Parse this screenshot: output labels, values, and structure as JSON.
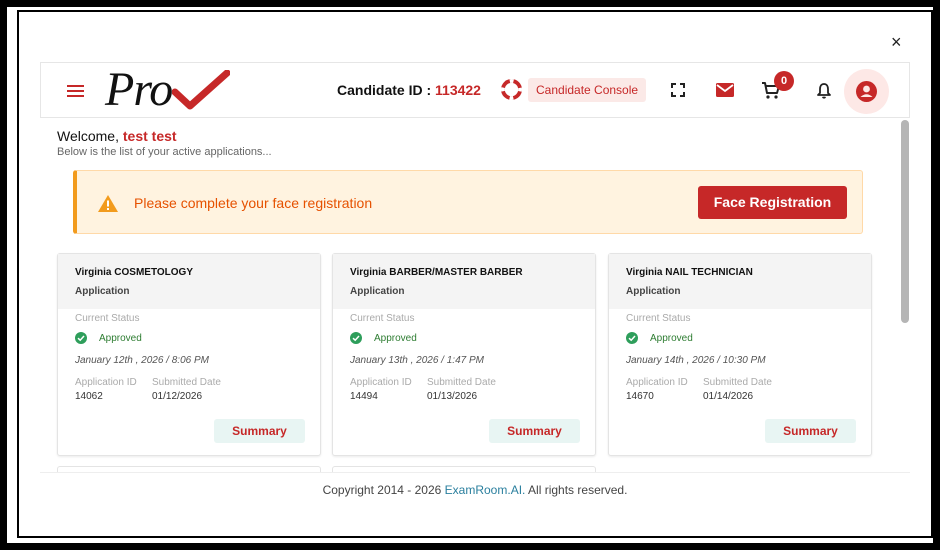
{
  "window": {
    "close_label": "×"
  },
  "header": {
    "logo_text": "Pro",
    "candidate_label": "Candidate ID : ",
    "candidate_id": "113422",
    "console_label": "Candidate Console",
    "cart_count": "0"
  },
  "welcome": {
    "greeting": "Welcome, ",
    "user_name": "test test",
    "subtitle": "Below is the list of your active applications..."
  },
  "alert": {
    "message": "Please complete your face registration",
    "button_label": "Face Registration"
  },
  "cards": [
    {
      "title": "Virginia COSMETOLOGY",
      "type": "Application",
      "status_label": "Current Status",
      "status": "Approved",
      "datetime": "January 12th , 2026 / 8:06 PM",
      "app_id_label": "Application ID",
      "submitted_label": "Submitted Date",
      "app_id": "14062",
      "submitted": "01/12/2026",
      "summary_label": "Summary"
    },
    {
      "title": "Virginia BARBER/MASTER BARBER",
      "type": "Application",
      "status_label": "Current Status",
      "status": "Approved",
      "datetime": "January 13th , 2026 / 1:47 PM",
      "app_id_label": "Application ID",
      "submitted_label": "Submitted Date",
      "app_id": "14494",
      "submitted": "01/13/2026",
      "summary_label": "Summary"
    },
    {
      "title": "Virginia NAIL TECHNICIAN",
      "type": "Application",
      "status_label": "Current Status",
      "status": "Approved",
      "datetime": "January 14th , 2026 / 10:30 PM",
      "app_id_label": "Application ID",
      "submitted_label": "Submitted Date",
      "app_id": "14670",
      "submitted": "01/14/2026",
      "summary_label": "Summary"
    }
  ],
  "footer": {
    "prefix": "Copyright 2014 - 2026 ",
    "link": "ExamRoom.AI.",
    "suffix": " All rights reserved."
  },
  "colors": {
    "brand": "#c62828",
    "approved": "#2e7d32",
    "alert_bg": "#fff3e0",
    "alert_accent": "#f29b1d"
  }
}
